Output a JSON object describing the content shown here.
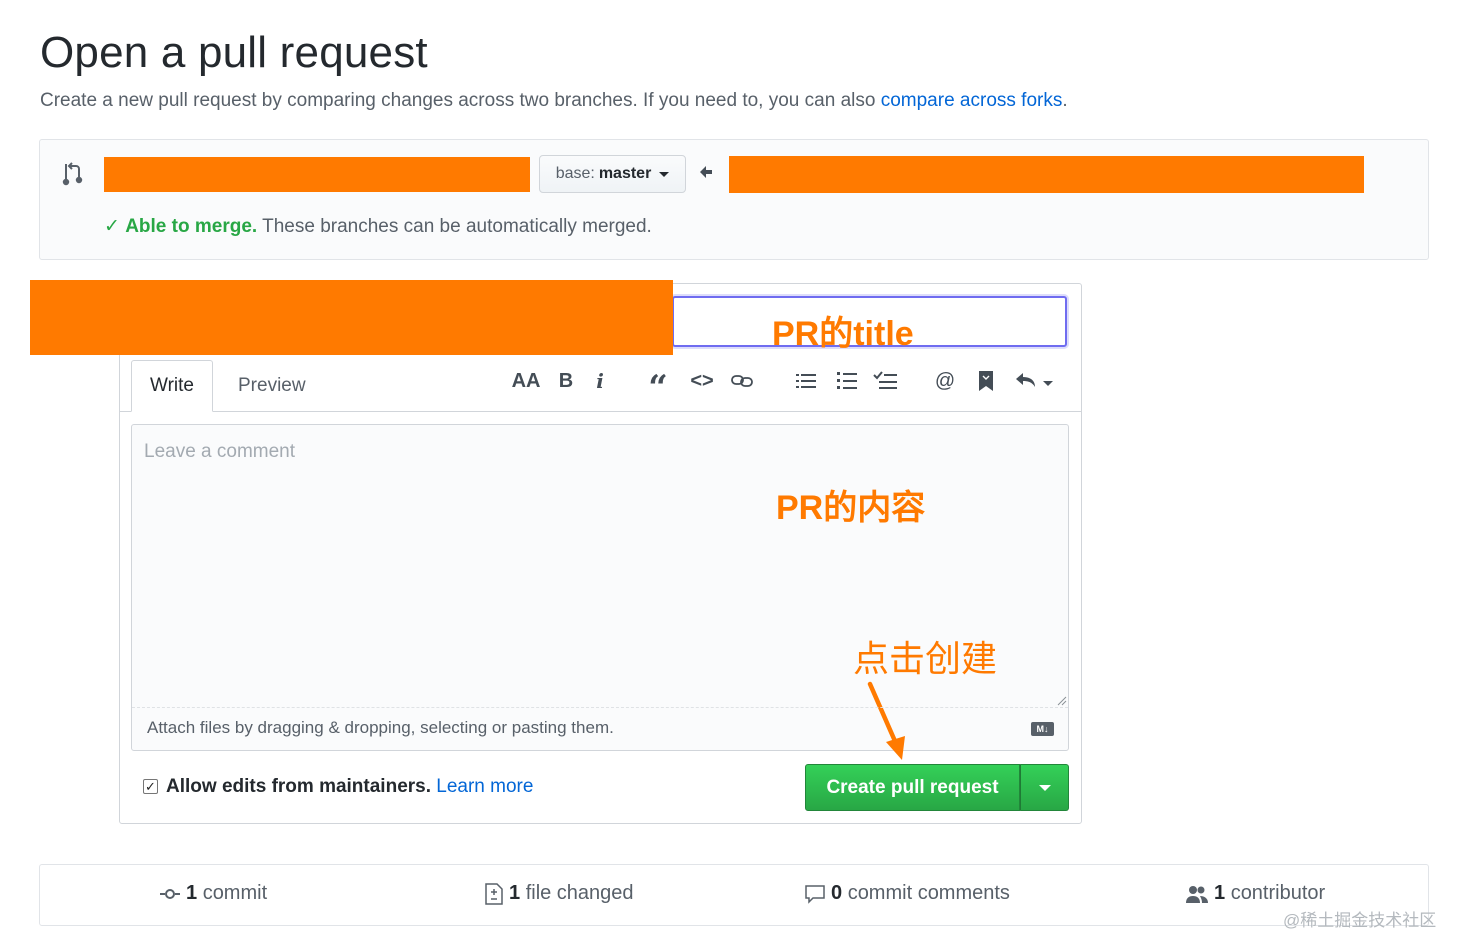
{
  "page": {
    "title": "Open a pull request",
    "subtitle_text": "Create a new pull request by comparing changes across two branches. If you need to, you can also ",
    "subtitle_link": "compare across forks",
    "subtitle_end": "."
  },
  "range": {
    "base_prefix": "base:",
    "base_branch": "master",
    "merge_status": "Able to merge.",
    "merge_message": " These branches can be automatically merged."
  },
  "editor": {
    "tabs": [
      "Write",
      "Preview"
    ],
    "toolbar": {
      "heading": "AA",
      "bold": "B",
      "italic": "i",
      "quote": "“",
      "code": "<>",
      "mention": "@"
    },
    "comment_placeholder": "Leave a comment",
    "attach_text": "Attach files by dragging & dropping, selecting or pasting them.",
    "markdown_badge": "M↓"
  },
  "footer": {
    "allow_edits_label": "Allow edits from maintainers.",
    "learn_more": "Learn more",
    "allow_edits_checked": true,
    "create_button": "Create pull request"
  },
  "annotations": {
    "title_note": "PR的title",
    "content_note": "PR的内容",
    "create_note": "点击创建"
  },
  "stats": {
    "commits_count": "1",
    "commits_label": "commit",
    "files_count": "1",
    "files_label": "file changed",
    "comments_count": "0",
    "comments_label": "commit comments",
    "contributors_count": "1",
    "contributors_label": "contributor"
  },
  "watermark": "@稀土掘金技术社区",
  "colors": {
    "accent_link": "#0366d6",
    "success": "#28a745",
    "redaction": "#ff7a00",
    "annotation": "#ff7a00"
  }
}
